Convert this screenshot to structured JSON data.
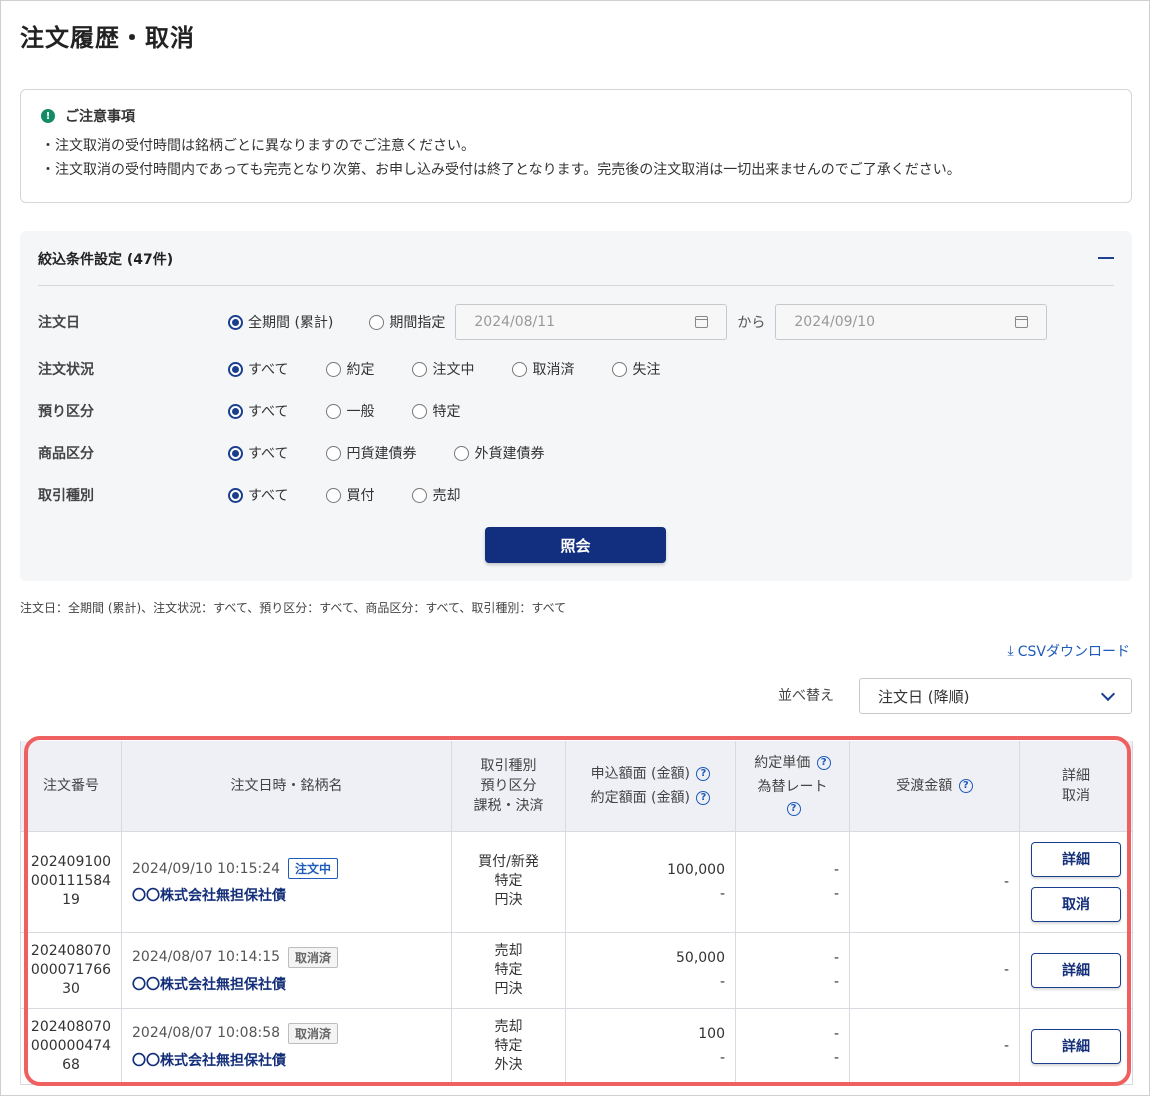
{
  "page_title": "注文履歴・取消",
  "notice": {
    "title": "ご注意事項",
    "lines": [
      "・注文取消の受付時間は銘柄ごとに異なりますのでご注意ください。",
      "・注文取消の受付時間内であっても完売となり次第、お申し込み受付は終了となります。完売後の注文取消は一切出来ませんのでご了承ください。"
    ]
  },
  "filter": {
    "heading": "絞込条件設定 (47件)",
    "order_date": {
      "label": "注文日",
      "opt_all": "全期間 (累計)",
      "opt_range": "期間指定",
      "from": "2024/08/11",
      "sep": "から",
      "to": "2024/09/10"
    },
    "status": {
      "label": "注文状況",
      "options": [
        "すべて",
        "約定",
        "注文中",
        "取消済",
        "失注"
      ]
    },
    "deposit": {
      "label": "預り区分",
      "options": [
        "すべて",
        "一般",
        "特定"
      ]
    },
    "product": {
      "label": "商品区分",
      "options": [
        "すべて",
        "円貨建債券",
        "外貨建債券"
      ]
    },
    "trade": {
      "label": "取引種別",
      "options": [
        "すべて",
        "買付",
        "売却"
      ]
    },
    "submit_label": "照会"
  },
  "summary": "注文日：全期間 (累計)、注文状況：すべて、預り区分：すべて、商品区分：すべて、取引種別：すべて",
  "csv_label": "CSVダウンロード",
  "sort": {
    "label": "並べ替え",
    "value": "注文日 (降順)"
  },
  "table": {
    "headers": {
      "order_no": "注文番号",
      "datetime_name": "注文日時・銘柄名",
      "type1": "取引種別",
      "type2": "預り区分",
      "type3": "課税・決済",
      "amount1": "申込額面 (金額)",
      "amount2": "約定額面 (金額)",
      "rate1": "約定単価",
      "rate2": "為替レート",
      "delivery": "受渡金額",
      "action1": "詳細",
      "action2": "取消"
    },
    "rows": [
      {
        "no1": "202409100",
        "no2": "000111584",
        "no3": "19",
        "datetime": "2024/09/10 10:15:24",
        "badge": "注文中",
        "name": "〇〇株式会社無担保社債",
        "t1": "買付/新発",
        "t2": "特定",
        "t3": "円決",
        "a1": "100,000",
        "a2": "-",
        "r1": "-",
        "r2": "-",
        "delivery": "-",
        "detail": "詳細",
        "cancel": "取消"
      },
      {
        "no1": "202408070",
        "no2": "000071766",
        "no3": "30",
        "datetime": "2024/08/07 10:14:15",
        "badge": "取消済",
        "name": "〇〇株式会社無担保社債",
        "t1": "売却",
        "t2": "特定",
        "t3": "円決",
        "a1": "50,000",
        "a2": "-",
        "r1": "-",
        "r2": "-",
        "delivery": "-",
        "detail": "詳細"
      },
      {
        "no1": "202408070",
        "no2": "000000474",
        "no3": "68",
        "datetime": "2024/08/07 10:08:58",
        "badge": "取消済",
        "name": "〇〇株式会社無担保社債",
        "t1": "売却",
        "t2": "特定",
        "t3": "外決",
        "a1": "100",
        "a2": "-",
        "r1": "-",
        "r2": "-",
        "delivery": "-",
        "detail": "詳細"
      }
    ]
  },
  "colors": {
    "primary": "#112f7e",
    "link": "#1f5bb8",
    "highlight": "#ef6060",
    "notice_icon": "#148a66"
  },
  "icons": {
    "notice": "exclamation-circle-icon",
    "calendar": "calendar-icon",
    "download": "download-icon",
    "help": "question-circle-icon",
    "collapse": "minus-icon",
    "dropdown": "chevron-down-icon"
  }
}
